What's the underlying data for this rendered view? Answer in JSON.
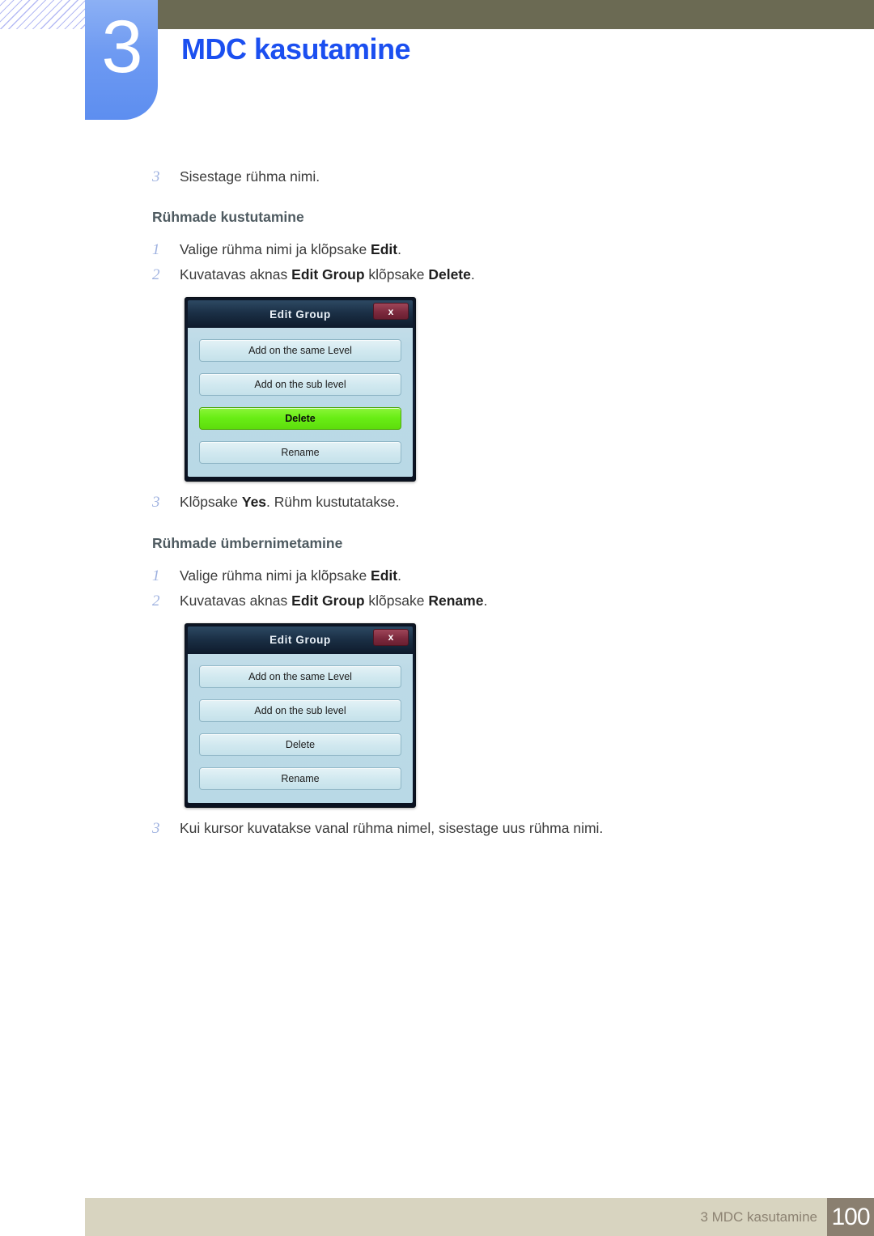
{
  "header": {
    "chapter_number": "3",
    "chapter_title": "MDC kasutamine"
  },
  "content": {
    "blocks": [
      {
        "type": "step",
        "marker": "3",
        "text_parts": [
          {
            "t": "Sisestage rühma nimi.",
            "bold": false
          }
        ]
      },
      {
        "type": "subhead",
        "text": "Rühmade kustutamine"
      },
      {
        "type": "step",
        "marker": "1",
        "text_parts": [
          {
            "t": "Valige rühma nimi ja klõpsake ",
            "bold": false
          },
          {
            "t": "Edit",
            "bold": true
          },
          {
            "t": ".",
            "bold": false
          }
        ]
      },
      {
        "type": "step",
        "marker": "2",
        "text_parts": [
          {
            "t": "Kuvatavas aknas ",
            "bold": false
          },
          {
            "t": "Edit Group",
            "bold": true
          },
          {
            "t": " klõpsake ",
            "bold": false
          },
          {
            "t": "Delete",
            "bold": true
          },
          {
            "t": ".",
            "bold": false
          }
        ]
      },
      {
        "type": "dialog",
        "dialog": {
          "title": "Edit Group",
          "close_label": "x",
          "buttons": [
            {
              "label": "Add on the same Level",
              "highlighted": false
            },
            {
              "label": "Add on the sub level",
              "highlighted": false
            },
            {
              "label": "Delete",
              "highlighted": true
            },
            {
              "label": "Rename",
              "highlighted": false
            }
          ]
        }
      },
      {
        "type": "step",
        "marker": "3",
        "text_parts": [
          {
            "t": "Klõpsake ",
            "bold": false
          },
          {
            "t": "Yes",
            "bold": true
          },
          {
            "t": ". Rühm kustutatakse.",
            "bold": false
          }
        ]
      },
      {
        "type": "subhead",
        "text": "Rühmade ümbernimetamine"
      },
      {
        "type": "step",
        "marker": "1",
        "text_parts": [
          {
            "t": "Valige rühma nimi ja klõpsake ",
            "bold": false
          },
          {
            "t": "Edit",
            "bold": true
          },
          {
            "t": ".",
            "bold": false
          }
        ]
      },
      {
        "type": "step",
        "marker": "2",
        "text_parts": [
          {
            "t": "Kuvatavas aknas ",
            "bold": false
          },
          {
            "t": "Edit Group",
            "bold": true
          },
          {
            "t": " klõpsake ",
            "bold": false
          },
          {
            "t": "Rename",
            "bold": true
          },
          {
            "t": ".",
            "bold": false
          }
        ]
      },
      {
        "type": "dialog",
        "dialog": {
          "title": "Edit Group",
          "close_label": "x",
          "buttons": [
            {
              "label": "Add on the same Level",
              "highlighted": false
            },
            {
              "label": "Add on the sub level",
              "highlighted": false
            },
            {
              "label": "Delete",
              "highlighted": false
            },
            {
              "label": "Rename",
              "highlighted": false
            }
          ]
        }
      },
      {
        "type": "step",
        "marker": "3",
        "text_parts": [
          {
            "t": "Kui kursor kuvatakse vanal rühma nimel, sisestage uus rühma nimi.",
            "bold": false
          }
        ]
      }
    ]
  },
  "footer": {
    "label": "3 MDC kasutamine",
    "page_number": "100"
  },
  "colors": {
    "chapter_title": "#1b4ff0",
    "tab_blue": "#6e9af2",
    "olive_bar": "#6b6a53",
    "footer_bar": "#d8d4c0",
    "footer_page_box": "#8a7f70",
    "subhead": "#4e5a60",
    "marker": "#9fb2e0",
    "dialog_highlight_green": "#6aee16",
    "dialog_close_red": "#7d2a3e"
  }
}
